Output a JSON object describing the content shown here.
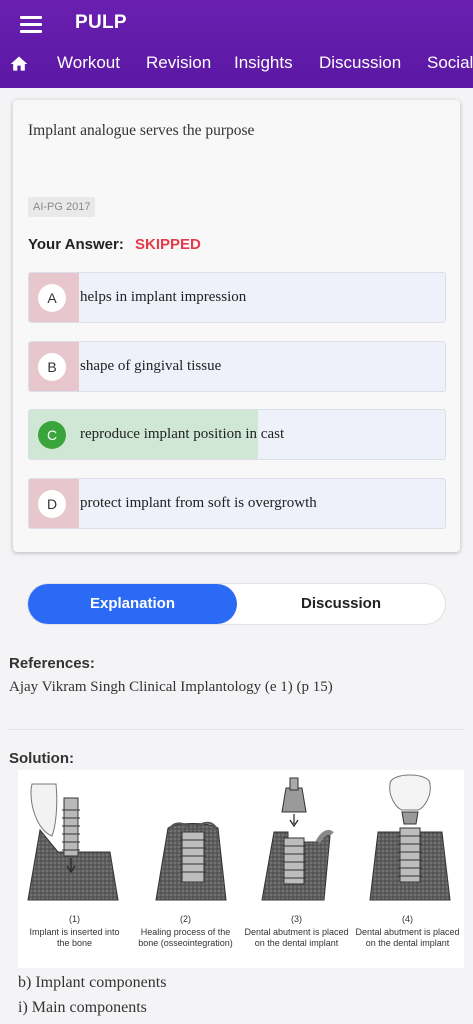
{
  "app": {
    "title": "PULP"
  },
  "nav": {
    "tabs": [
      "Workout",
      "Revision",
      "Insights",
      "Discussion",
      "Social"
    ]
  },
  "question": {
    "text": "Implant analogue serves the purpose",
    "tag": "AI-PG 2017",
    "your_answer_label": "Your Answer:",
    "your_answer_value": "SKIPPED"
  },
  "options": [
    {
      "letter": "A",
      "text": "helps in implant impression",
      "percent": 12,
      "correct": false
    },
    {
      "letter": "B",
      "text": "shape of gingival tissue",
      "percent": 12,
      "correct": false
    },
    {
      "letter": "C",
      "text": "reproduce implant position in cast",
      "percent": 55,
      "correct": true
    },
    {
      "letter": "D",
      "text": "protect implant from soft is overgrowth",
      "percent": 12,
      "correct": false
    }
  ],
  "toggle": {
    "active": "Explanation",
    "other": "Discussion"
  },
  "explanation": {
    "references_label": "References:",
    "reference": "Ajay Vikram Singh Clinical Implantology (e 1) (p 15)",
    "solution_label": "Solution:",
    "figure_captions": [
      {
        "num": "(1)",
        "text": "Implant is inserted into the bone"
      },
      {
        "num": "(2)",
        "text": "Healing process of the bone (osseointegration)"
      },
      {
        "num": "(3)",
        "text": "Dental abutment is placed on the dental implant"
      },
      {
        "num": "(4)",
        "text": "Dental abutment is placed on the dental implant"
      }
    ],
    "line1": "b) Implant components",
    "line2": "i) Main components"
  },
  "colors": {
    "appbar": "#5a18a3",
    "accent": "#2a6af5",
    "skipped": "#e33b4b",
    "correct": "#3aa53d"
  }
}
